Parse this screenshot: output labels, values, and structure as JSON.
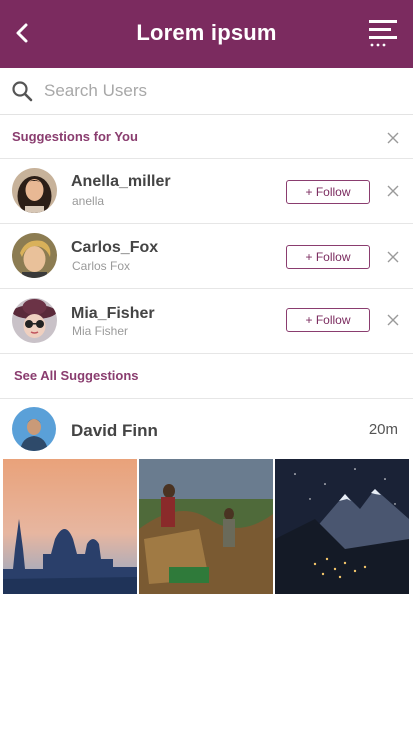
{
  "header": {
    "title": "Lorem ipsum",
    "back_icon": "chevron-left-icon",
    "menu_icon": "menu-icon",
    "color": "#7b2b5f"
  },
  "search": {
    "placeholder": "Search Users",
    "value": "",
    "icon": "search-icon"
  },
  "suggestions": {
    "title": "Suggestions for You",
    "users": [
      {
        "name": "Anella_miller",
        "subtitle": "anella",
        "button": "+ Follow"
      },
      {
        "name": "Carlos_Fox",
        "subtitle": "Carlos Fox",
        "button": "+ Follow"
      },
      {
        "name": "Mia_Fisher",
        "subtitle": "Mia Fisher",
        "button": "+ Follow"
      }
    ],
    "see_all": "See All Suggestions"
  },
  "post": {
    "author": "David Finn",
    "time": "20m",
    "photos": [
      "city-skyline-sunset",
      "farm-harvest",
      "mountain-night-village"
    ]
  },
  "accent": "#8a3d6f"
}
